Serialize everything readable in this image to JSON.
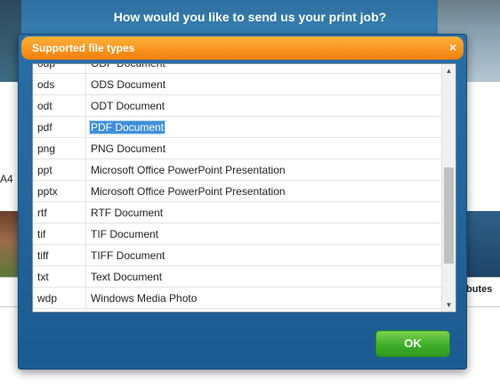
{
  "background": {
    "heading": "How would you like to send us your print job?",
    "paper_size": "A4",
    "table_fragment": "tributes"
  },
  "dialog": {
    "title": "Supported file types",
    "close_glyph": "×",
    "ok_label": "OK",
    "partial_top_row": {
      "ext": "odp",
      "desc": "ODP Document"
    },
    "rows": [
      {
        "ext": "ods",
        "desc": "ODS Document"
      },
      {
        "ext": "odt",
        "desc": "ODT Document"
      },
      {
        "ext": "pdf",
        "desc": "PDF Document",
        "selected": true
      },
      {
        "ext": "png",
        "desc": "PNG Document"
      },
      {
        "ext": "ppt",
        "desc": "Microsoft Office PowerPoint Presentation"
      },
      {
        "ext": "pptx",
        "desc": "Microsoft Office PowerPoint Presentation"
      },
      {
        "ext": "rtf",
        "desc": "RTF Document"
      },
      {
        "ext": "tif",
        "desc": "TIF Document"
      },
      {
        "ext": "tiff",
        "desc": "TIFF Document"
      },
      {
        "ext": "txt",
        "desc": "Text Document"
      },
      {
        "ext": "wdp",
        "desc": "Windows Media Photo"
      }
    ],
    "scroll_up_glyph": "▲",
    "scroll_down_glyph": "▼"
  },
  "colors": {
    "titlebar": "#f7921c",
    "dialog_body": "#1c5b91",
    "selection": "#3f8fd8",
    "ok_button": "#3fae2a"
  }
}
